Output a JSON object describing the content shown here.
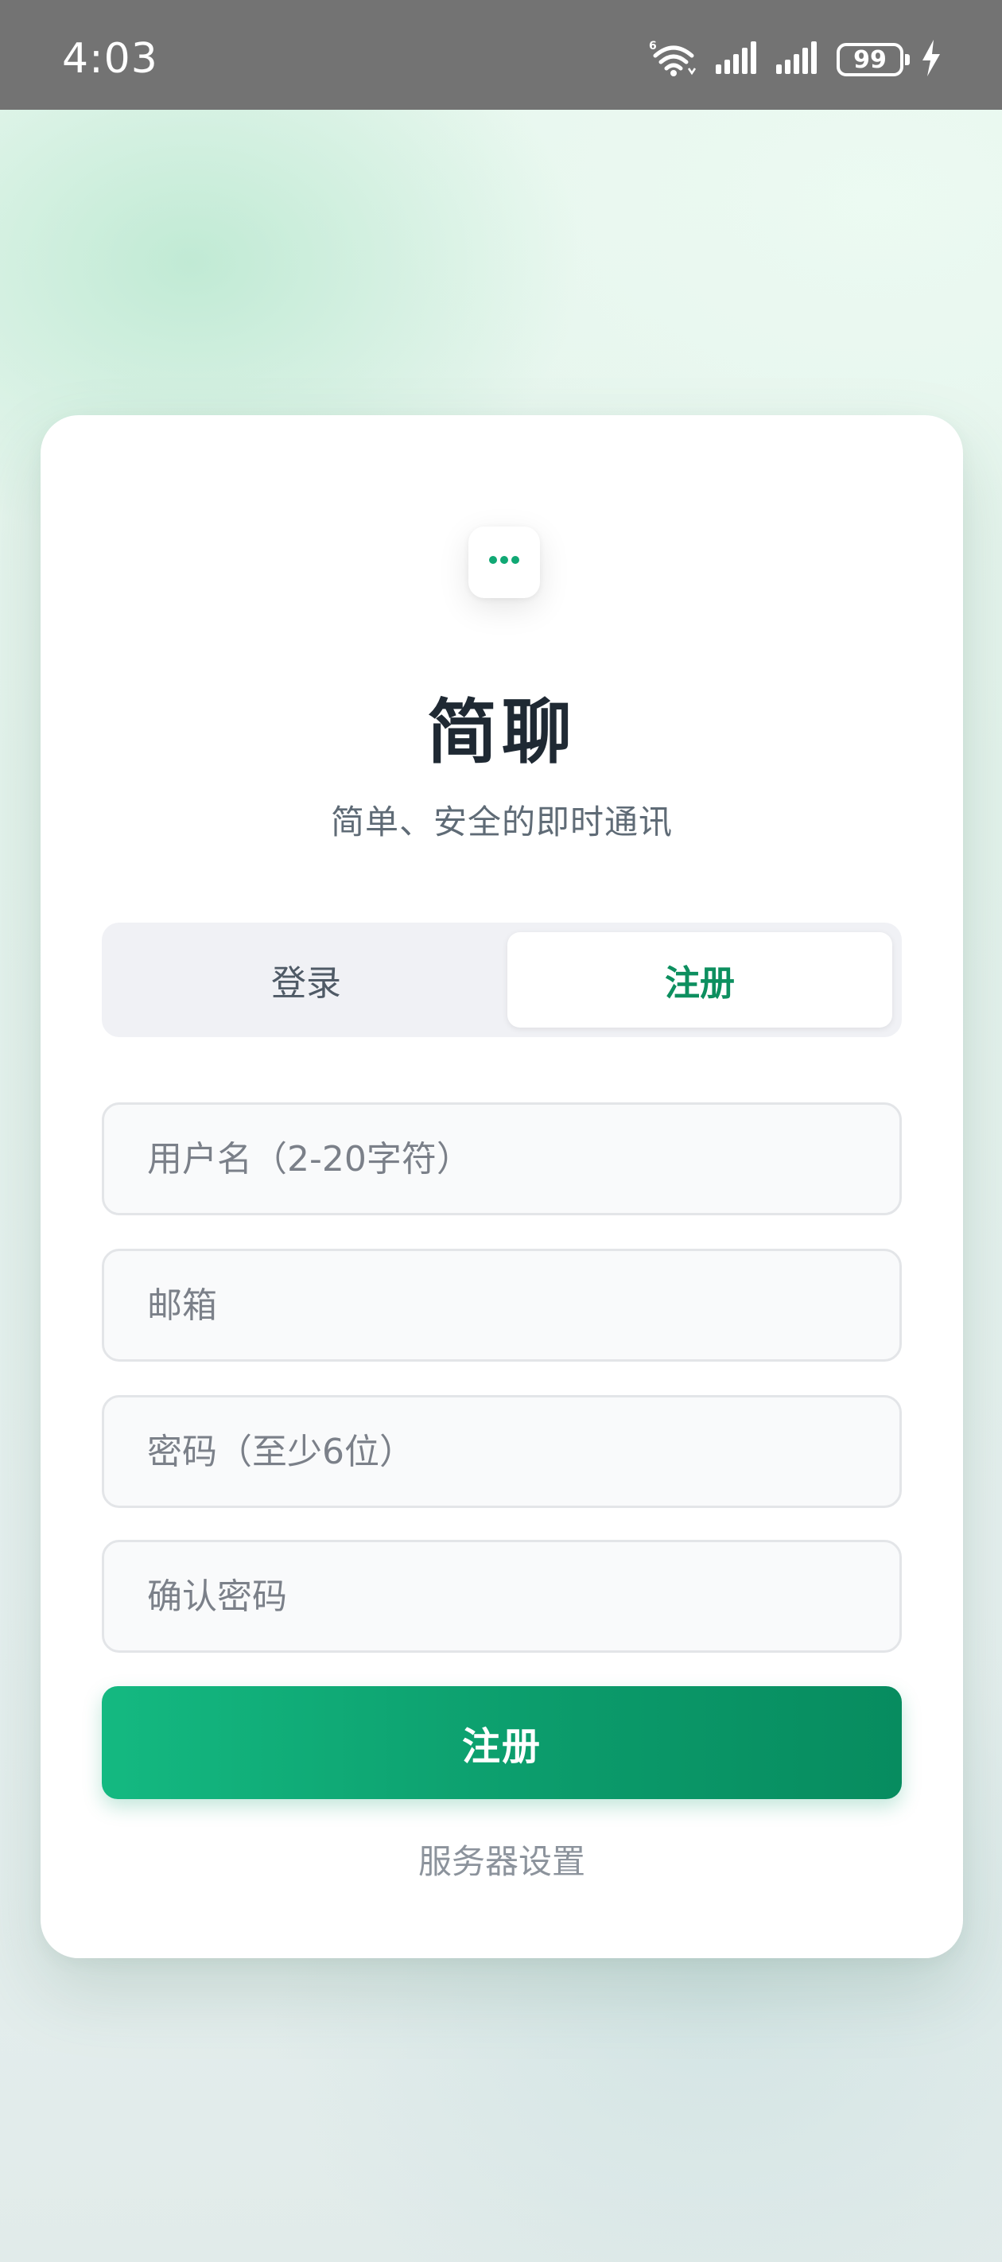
{
  "status_bar": {
    "time": "4:03",
    "battery": "99",
    "wifi_badge": "6"
  },
  "app": {
    "title": "简聊",
    "subtitle": "简单、安全的即时通讯",
    "logo_icon": "chat-bubble-icon",
    "accent_color": "#10a874"
  },
  "tabs": {
    "login": "登录",
    "register": "注册",
    "active": "register"
  },
  "form": {
    "username_placeholder": "用户名（2-20字符）",
    "email_placeholder": "邮箱",
    "password_placeholder": "密码（至少6位）",
    "confirm_placeholder": "确认密码",
    "submit_label": "注册"
  },
  "footer": {
    "server_settings": "服务器设置"
  }
}
